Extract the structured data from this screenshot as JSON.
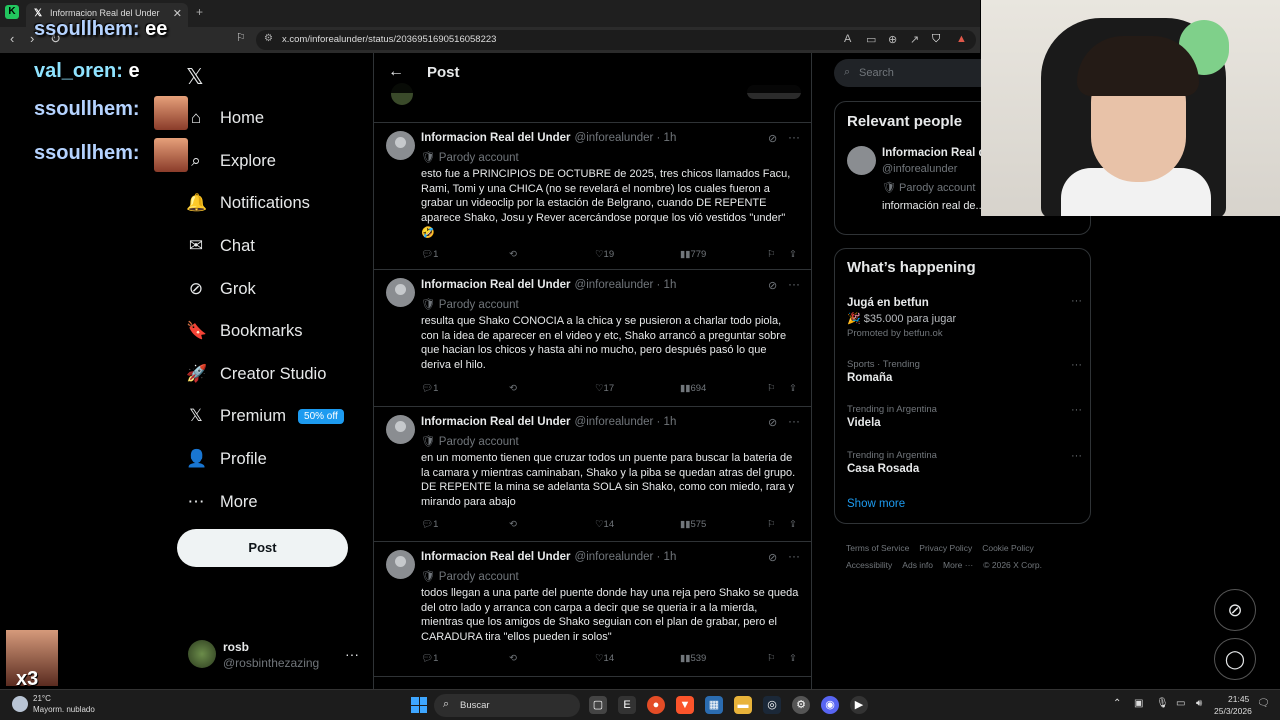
{
  "browser": {
    "tab_title": "Informacion Real del Under on X:",
    "tab_close": "✕",
    "new_tab": "+",
    "url": "x.com/inforealunder/status/2036951690516058223"
  },
  "stream_chat": [
    {
      "user": "ssoullhem:",
      "msg": "ee"
    },
    {
      "user": "val_oren:",
      "msg": "e"
    },
    {
      "user": "ssoullhem:",
      "msg": ""
    },
    {
      "user": "ssoullhem:",
      "msg": ""
    }
  ],
  "stream_overlay_badge": "x3",
  "nav": {
    "items": [
      {
        "label": "Home",
        "icon": "⌂"
      },
      {
        "label": "Explore",
        "icon": "⌕"
      },
      {
        "label": "Notifications",
        "icon": "🔔"
      },
      {
        "label": "Chat",
        "icon": "✉"
      },
      {
        "label": "Grok",
        "icon": "⊘"
      },
      {
        "label": "Bookmarks",
        "icon": "🔖"
      },
      {
        "label": "Creator Studio",
        "icon": "🚀"
      },
      {
        "label": "Premium",
        "icon": "𝕏"
      },
      {
        "label": "Profile",
        "icon": "👤"
      },
      {
        "label": "More",
        "icon": "⋯"
      }
    ],
    "premium_badge": "50% off",
    "post_button": "Post"
  },
  "account": {
    "name": "rosb",
    "handle": "@rosbinthezazing",
    "more": "···"
  },
  "main": {
    "title": "Post",
    "tweets": [
      {
        "name": "Informacion Real del Under",
        "handle": "@inforealunder · 1h",
        "parody": "Parody account",
        "body": "esto fue a PRINCIPIOS DE OCTUBRE de 2025, tres chicos llamados Facu, Rami, Tomi y una CHICA (no se revelará el nombre) los cuales fueron a grabar un videoclip por la estación de Belgrano, cuando DE REPENTE aparece Shako, Josu y Rever acercándose porque los vió vestidos \"under\" 🤣",
        "replies": "1",
        "reposts": "",
        "likes": "19",
        "views": "779"
      },
      {
        "name": "Informacion Real del Under",
        "handle": "@inforealunder · 1h",
        "parody": "Parody account",
        "body": "resulta que Shako CONOCIA a la chica y se pusieron a charlar todo piola, con la idea de aparecer en el video y etc, Shako arrancó a preguntar sobre que hacian los chicos y hasta ahi no mucho, pero después pasó lo que deriva el hilo.",
        "replies": "1",
        "reposts": "",
        "likes": "17",
        "views": "694"
      },
      {
        "name": "Informacion Real del Under",
        "handle": "@inforealunder · 1h",
        "parody": "Parody account",
        "body": "en un momento tienen que cruzar todos un puente para buscar la bateria de la camara y mientras caminaban, Shako y la piba se quedan atras del grupo. DE REPENTE la mina se adelanta SOLA sin Shako, como con miedo, rara y mirando para abajo",
        "replies": "1",
        "reposts": "",
        "likes": "14",
        "views": "575"
      },
      {
        "name": "Informacion Real del Under",
        "handle": "@inforealunder · 1h",
        "parody": "Parody account",
        "body": "todos llegan a una parte del puente donde hay una reja pero Shako se queda del otro lado y arranca con carpa a decir que se queria ir a la mierda, mientras que los amigos de Shako seguian con el plan de grabar, pero el CARADURA tira \"ellos pueden ir solos\"",
        "replies": "1",
        "reposts": "",
        "likes": "14",
        "views": "539"
      }
    ]
  },
  "right": {
    "search_placeholder": "Search",
    "relevant_title": "Relevant people",
    "relevant": {
      "name": "Informacion Real d",
      "handle": "@inforealunder",
      "parody": "Parody account",
      "bio": "información real de... ALABAMOS A DIOS 🙏🏻🤍"
    },
    "happening_title": "What’s happening",
    "trends": [
      {
        "meta": "",
        "title": "Jugá en betfun",
        "sub": "🎉 $35.000 para jugar",
        "promo": "Promoted by betfun.ok"
      },
      {
        "meta": "Sports · Trending",
        "title": "Romaña",
        "sub": "",
        "promo": ""
      },
      {
        "meta": "Trending in Argentina",
        "title": "Videla",
        "sub": "",
        "promo": ""
      },
      {
        "meta": "Trending in Argentina",
        "title": "Casa Rosada",
        "sub": "",
        "promo": ""
      }
    ],
    "show_more": "Show more",
    "footer": [
      "Terms of Service",
      "Privacy Policy",
      "Cookie Policy",
      "Accessibility",
      "Ads info",
      "More ···",
      "© 2026 X Corp."
    ]
  },
  "taskbar": {
    "temp": "21°C",
    "weather": "Mayorm. nublado",
    "search": "Buscar",
    "time": "21:45",
    "date": "25/3/2026"
  }
}
